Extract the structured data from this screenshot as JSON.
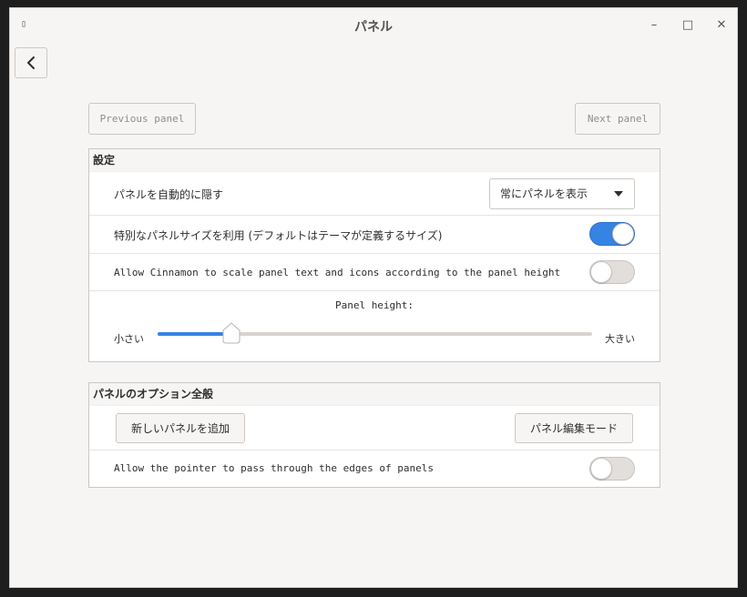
{
  "window": {
    "title": "パネル",
    "app_icon_glyph": "▯",
    "minimize_glyph": "–",
    "maximize_glyph": "□",
    "close_glyph": "✕"
  },
  "nav": {
    "previous_label": "Previous panel",
    "next_label": "Next panel"
  },
  "settings_section": {
    "header": "設定",
    "autohide": {
      "label": "パネルを自動的に隠す",
      "selected_option": "常にパネルを表示"
    },
    "custom_size": {
      "label": "特別なパネルサイズを利用 (デフォルトはテーマが定義するサイズ)",
      "enabled": true
    },
    "scale_text": {
      "label": "Allow Cinnamon to scale panel text and icons according to the panel height",
      "enabled": false
    },
    "panel_height": {
      "label": "Panel height:",
      "min_label": "小さい",
      "max_label": "大きい",
      "value_fraction": 0.17
    }
  },
  "general_section": {
    "header": "パネルのオプション全般",
    "add_panel_label": "新しいパネルを追加",
    "edit_mode_label": "パネル編集モード",
    "pointer_pass": {
      "label": "Allow the pointer to pass through the edges of panels",
      "enabled": false
    }
  },
  "colors": {
    "accent": "#3584e4",
    "background": "#f6f5f4"
  }
}
